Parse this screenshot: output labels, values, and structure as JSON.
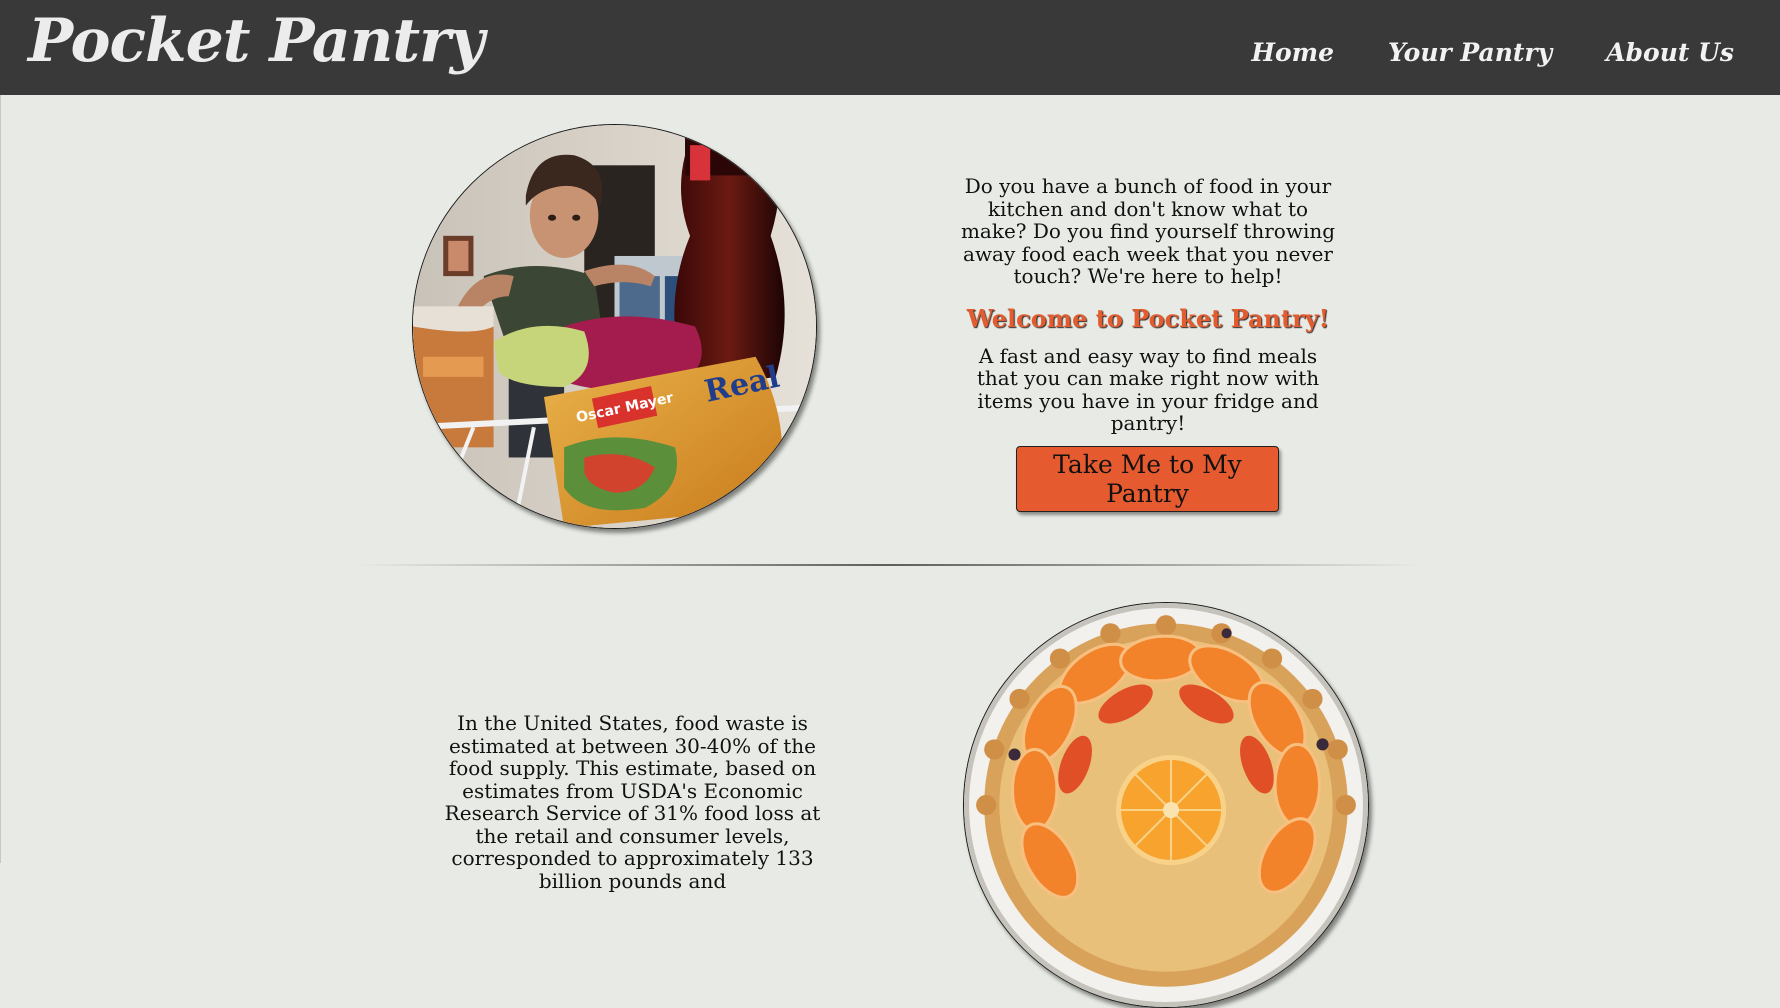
{
  "nav": {
    "brand": "Pocket Pantry",
    "links": [
      "Home",
      "Your Pantry",
      "About Us"
    ]
  },
  "intro": {
    "question": "Do you have a bunch of food in your kitchen and don't know what to make? Do you find yourself throwing away food each week that you never touch? We're here to help!",
    "welcome": "Welcome to Pocket Pantry!",
    "tagline": "A fast and easy way to find meals that you can make right now with items you have in your fridge and pantry!",
    "cta_label": "Take Me to My Pantry"
  },
  "stats": {
    "text": "In the United States, food waste is estimated at between 30-40% of the food supply. This estimate, based on estimates from USDA's Economic Research Service of 31% food loss at the retail and consumer levels, corresponded to approximately 133 billion pounds and"
  },
  "colors": {
    "navbar": "#393939",
    "background": "#e8ebe5",
    "accent": "#e65a2f"
  }
}
